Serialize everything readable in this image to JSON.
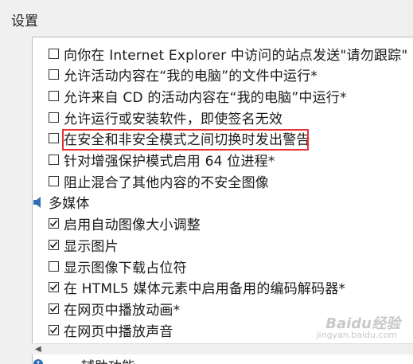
{
  "section_title": "设置",
  "items": [
    {
      "type": "checkbox",
      "label": "向你在 Internet Explorer 中访问的站点发送\"请勿跟踪\"",
      "checked": false
    },
    {
      "type": "checkbox",
      "label": "允许活动内容在“我的电脑”的文件中运行*",
      "checked": false
    },
    {
      "type": "checkbox",
      "label": "允许来自 CD 的活动内容在“我的电脑”中运行*",
      "checked": false
    },
    {
      "type": "checkbox",
      "label": "允许运行或安装软件，即使签名无效",
      "checked": false
    },
    {
      "type": "checkbox",
      "label": "在安全和非安全模式之间切换时发出警告",
      "checked": false,
      "highlighted": true
    },
    {
      "type": "checkbox",
      "label": "针对增强保护模式启用 64 位进程*",
      "checked": false
    },
    {
      "type": "checkbox",
      "label": "阻止混合了其他内容的不安全图像",
      "checked": false
    },
    {
      "type": "category",
      "label": "多媒体",
      "icon": "multimedia-icon"
    },
    {
      "type": "checkbox",
      "label": "启用自动图像大小调整",
      "checked": true
    },
    {
      "type": "checkbox",
      "label": "显示图片",
      "checked": true
    },
    {
      "type": "checkbox",
      "label": "显示图像下载占位符",
      "checked": false
    },
    {
      "type": "checkbox",
      "label": "在 HTML5 媒体元素中启用备用的编码解码器*",
      "checked": true
    },
    {
      "type": "checkbox",
      "label": "在网页中播放动画*",
      "checked": true
    },
    {
      "type": "checkbox",
      "label": "在网页中播放声音",
      "checked": true
    }
  ],
  "partial_category": "辅助功能",
  "watermark": "Baidu经验",
  "watermark_sub": "jingyan.baidu.com",
  "colors": {
    "highlight": "#e53333",
    "check": "#1a1a1a"
  }
}
